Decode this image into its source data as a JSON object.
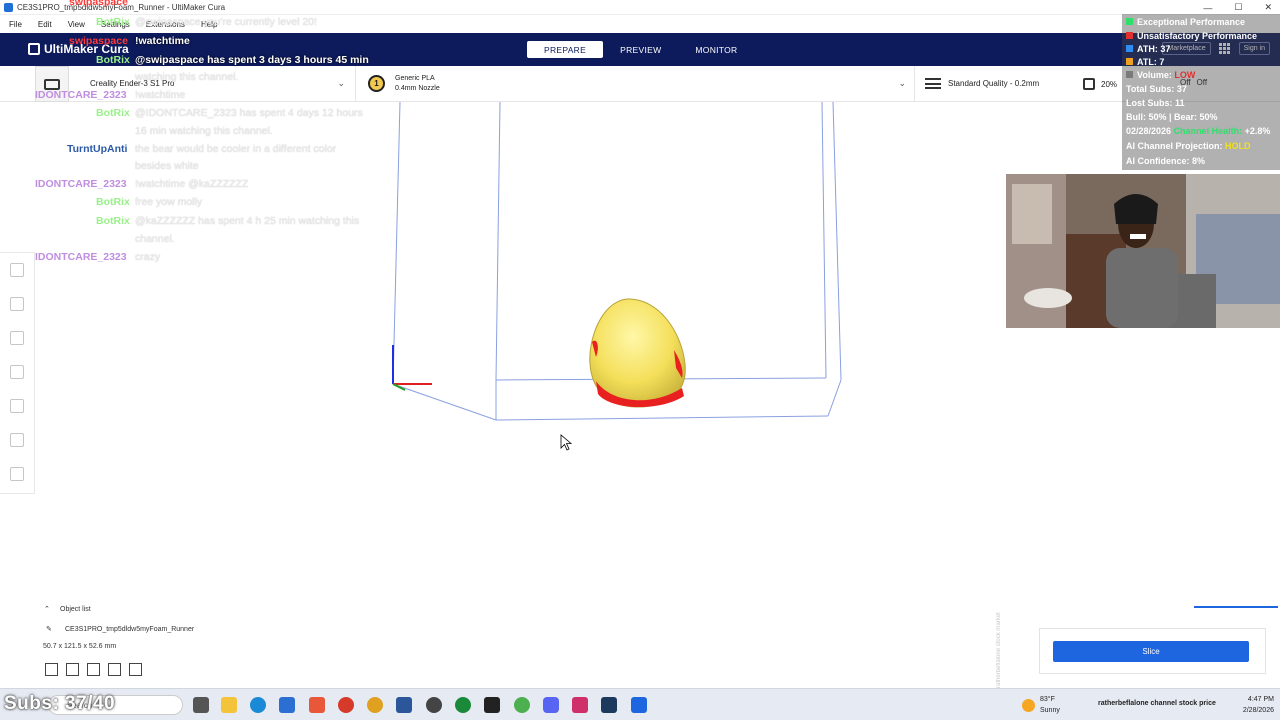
{
  "window": {
    "title": "CE3S1PRO_tmp5dldw5myFoam_Runner - UltiMaker Cura",
    "min": "—",
    "max": "☐",
    "close": "✕"
  },
  "menu": [
    "File",
    "Edit",
    "View",
    "Settings",
    "Extensions",
    "Help"
  ],
  "header": {
    "logo": "UltiMaker Cura",
    "stages": [
      "PREPARE",
      "PREVIEW",
      "MONITOR"
    ],
    "marketplace": "Marketplace",
    "signin": "Sign in"
  },
  "toolbar": {
    "printer": "Creality Ender-3 S1 Pro",
    "material_badge": "1",
    "material": "Generic PLA",
    "nozzle": "0.4mm Nozzle",
    "quality": "Standard Quality - 0.2mm",
    "infill": "20%",
    "support": "Off",
    "adhesion": "Off"
  },
  "chat": [
    {
      "user": "swipaspace",
      "color": "#ff3a3a",
      "msg": "",
      "style": "strong"
    },
    {
      "user": "BotRix",
      "color": "#9af08a",
      "msg": "@swipaspace you're currently level 20!",
      "style": "light"
    },
    {
      "user": "swipaspace",
      "color": "#ff3a3a",
      "msg": "!watchtime",
      "style": "strong"
    },
    {
      "user": "BotRix",
      "color": "#9af08a",
      "msg": "@swipaspace has spent 3 days 3 hours 45 min",
      "style": "strong"
    },
    {
      "user": "",
      "color": "#9af08a",
      "msg": "watching this channel.",
      "style": "light"
    },
    {
      "user": "IDONTCARE_2323",
      "color": "#c08ee0",
      "msg": "!watchtime",
      "style": "light"
    },
    {
      "user": "BotRix",
      "color": "#9af08a",
      "msg": "@IDONTCARE_2323 has spent 4 days 12 hours",
      "style": "light"
    },
    {
      "user": "",
      "color": "#9af08a",
      "msg": "16 min watching this channel.",
      "style": "light"
    },
    {
      "user": "TurntUpAnti",
      "color": "#2a5aa8",
      "msg": "the bear would be cooler in a different color",
      "style": "light"
    },
    {
      "user": "",
      "color": "#2a5aa8",
      "msg": "besides white",
      "style": "light"
    },
    {
      "user": "IDONTCARE_2323",
      "color": "#c08ee0",
      "msg": "!watchtime @kaZZZZZZ",
      "style": "light"
    },
    {
      "user": "BotRix",
      "color": "#9af08a",
      "msg": "free yow molly",
      "style": "light"
    },
    {
      "user": "BotRix",
      "color": "#9af08a",
      "msg": "@kaZZZZZZ has spent 4 h 25 min watching this",
      "style": "light"
    },
    {
      "user": "",
      "color": "#9af08a",
      "msg": "channel.",
      "style": "light"
    },
    {
      "user": "IDONTCARE_2323",
      "color": "#c08ee0",
      "msg": "crazy",
      "style": "light"
    }
  ],
  "stats": {
    "exceptional": "Exceptional Performance",
    "unsatisfactory": "Unsatisfactory Performance",
    "ath_label": "ATH:",
    "ath": "37",
    "atl_label": "ATL:",
    "atl": "7",
    "volume_label": "Volume:",
    "volume": "LOW",
    "total_subs": "Total Subs: 37",
    "lost_subs": "Lost Subs: 11",
    "bull_bear": "Bull: 50% | Bear: 50%",
    "date": "02/28/2026",
    "health_label": "Channel Health:",
    "health": "+2.8%",
    "projection_label": "AI Channel Projection:",
    "projection": "HOLD",
    "confidence": "AI Confidence: 8%",
    "colors": {
      "green": "#2ee06a",
      "red": "#e03030",
      "blue": "#2f8cf0",
      "orange": "#f0a020",
      "gray": "#7a7a7a",
      "yellow": "#f0e020"
    }
  },
  "objects": {
    "header": "Object list",
    "name": "CE3S1PRO_tmp5dldw5myFoam_Runner",
    "dims": "50.7 x 121.5 x 52.6 mm"
  },
  "slice": {
    "label": "Slice"
  },
  "taskbar": {
    "subs": "Subs: 37/40",
    "search": "Search",
    "weather_temp": "83°F",
    "weather_desc": "Sunny",
    "ticker": "ratherbeflalone channel stock price",
    "time": "4:47 PM",
    "date": "2/28/2026"
  },
  "vertical_watermark": "ratherbeflalone stock market"
}
